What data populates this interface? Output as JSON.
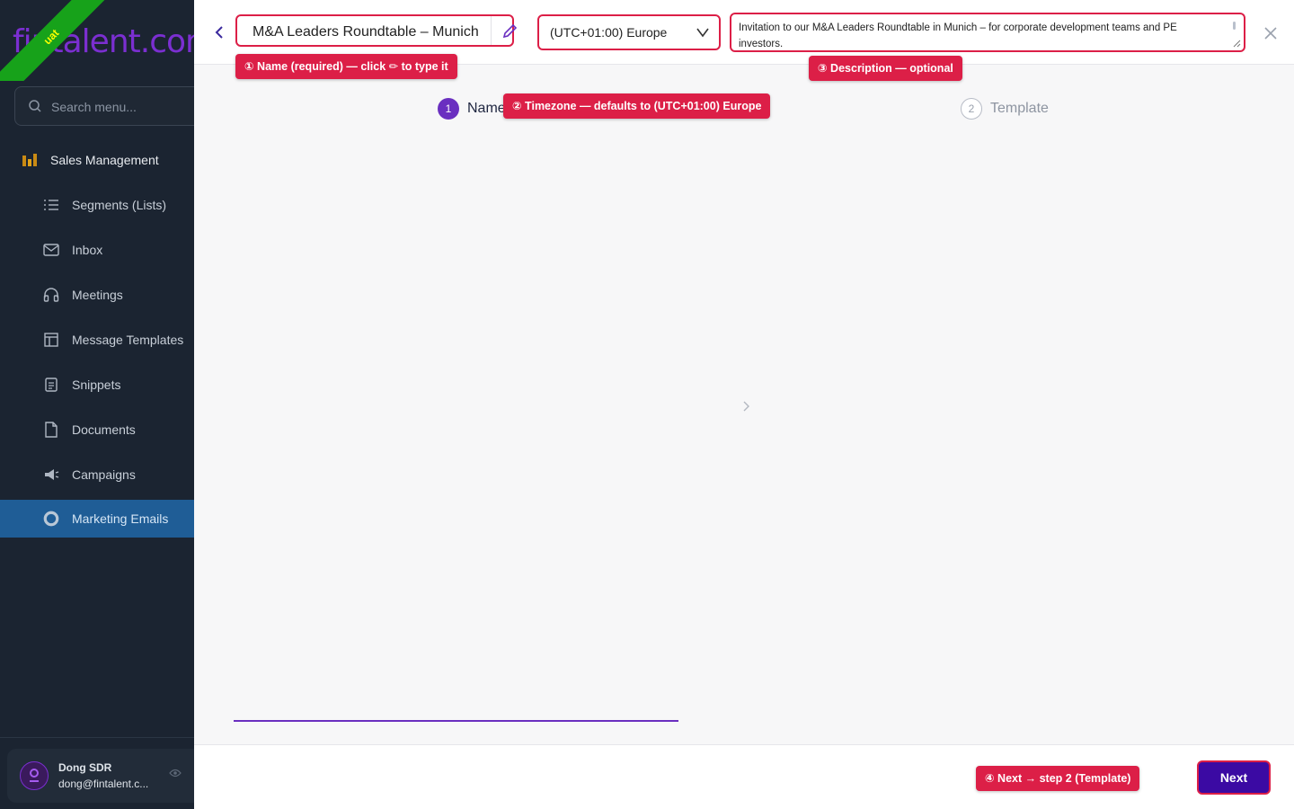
{
  "brand": {
    "logo_text": "fintalent.com",
    "env_badge": "uat"
  },
  "sidebar": {
    "search_placeholder": "Search menu...",
    "section_title": "Sales Management",
    "items": [
      {
        "label": "Segments (Lists)",
        "icon": "list-icon"
      },
      {
        "label": "Inbox",
        "icon": "inbox-icon"
      },
      {
        "label": "Meetings",
        "icon": "headphones-icon"
      },
      {
        "label": "Message Templates",
        "icon": "template-icon"
      },
      {
        "label": "Snippets",
        "icon": "snippet-icon"
      },
      {
        "label": "Documents",
        "icon": "document-icon"
      },
      {
        "label": "Campaigns",
        "icon": "megaphone-icon"
      },
      {
        "label": "Marketing Emails",
        "icon": "circle-icon",
        "active": true
      }
    ],
    "user": {
      "name": "Dong SDR",
      "email": "dong@fintalent.c..."
    }
  },
  "form": {
    "name_value": "M&A Leaders Roundtable – Munich",
    "timezone_value": "(UTC+01:00) Europe",
    "description_value": "Invitation to our M&A Leaders Roundtable in Munich – for corporate development teams and PE investors."
  },
  "annotations": {
    "name": "① Name (required) — click ✏ to type it",
    "timezone": "② Timezone — defaults to (UTC+01:00) Europe",
    "description": "③ Description — optional",
    "next": "④ Next → step 2 (Template)"
  },
  "steps": [
    {
      "number": "1",
      "label": "Name"
    },
    {
      "number": "2",
      "label": "Template"
    }
  ],
  "footer": {
    "next_label": "Next"
  },
  "colors": {
    "accent": "#6a2fc0",
    "annotation": "#dc1f47",
    "sidebar_bg": "#1b2431",
    "active_nav": "#1f5d96"
  }
}
